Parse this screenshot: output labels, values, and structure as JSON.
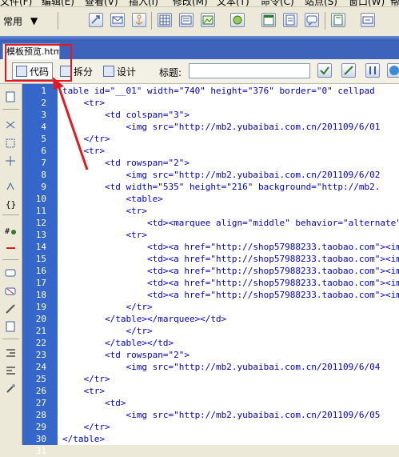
{
  "menubar": {
    "items": [
      "文件(F)",
      "编辑(E)",
      "查看(V)",
      "插入(I)",
      "修改(M)",
      "文本(T)",
      "命令(C)",
      "站点(S)",
      "窗口(W)",
      "帮"
    ]
  },
  "toolbar": {
    "category": "常用",
    "icons": [
      "hyperlink-icon",
      "email-link-icon",
      "named-anchor-icon",
      "table-icon",
      "div-icon",
      "image-icon",
      "media-icon",
      "date-icon",
      "server-include-icon",
      "comment-icon",
      "template-icon",
      "tag-chooser-icon"
    ]
  },
  "document_tab": {
    "label": "模板预览.htm"
  },
  "doc_toolbar": {
    "code_label": "代码",
    "split_label": "拆分",
    "design_label": "设计",
    "title_label": "标题:",
    "title_value": ""
  },
  "code_lines": [
    {
      "n": "1",
      "code": "table id=\"__01\" width=\"740\" height=\"376\" border=\"0\" cellpad"
    },
    {
      "n": "2",
      "code": "    <tr>"
    },
    {
      "n": "3",
      "code": "        <td colspan=\"3\">"
    },
    {
      "n": "4",
      "code": "            <img src=\"http://mb2.yubaibai.com.cn/201109/6/01"
    },
    {
      "n": "5",
      "code": "    </tr>"
    },
    {
      "n": "6",
      "code": "    <tr>"
    },
    {
      "n": "7",
      "code": "        <td rowspan=\"2\">"
    },
    {
      "n": "8",
      "code": "            <img src=\"http://mb2.yubaibai.com.cn/201109/6/02"
    },
    {
      "n": "9",
      "code": "        <td width=\"535\" height=\"216\" background=\"http://mb2."
    },
    {
      "n": "10",
      "code": "            <table>"
    },
    {
      "n": "11",
      "code": "            <tr>"
    },
    {
      "n": "12",
      "code": "                <td><marquee align=\"middle\" behavior=\"alternate\""
    },
    {
      "n": "13",
      "code": "            <tr>"
    },
    {
      "n": "14",
      "code": "                <td><a href=\"http://shop57988233.taobao.com\"><im"
    },
    {
      "n": "15",
      "code": "                <td><a href=\"http://shop57988233.taobao.com\"><im"
    },
    {
      "n": "16",
      "code": "                <td><a href=\"http://shop57988233.taobao.com\"><im"
    },
    {
      "n": "17",
      "code": "                <td><a href=\"http://shop57988233.taobao.com\"><im"
    },
    {
      "n": "18",
      "code": "                <td><a href=\"http://shop57988233.taobao.com\"><im"
    },
    {
      "n": "19",
      "code": "            </tr>"
    },
    {
      "n": "20",
      "code": "        </table></marquee></td>"
    },
    {
      "n": "21",
      "code": "            </tr>"
    },
    {
      "n": "22",
      "code": "        </table></td>"
    },
    {
      "n": "23",
      "code": "        <td rowspan=\"2\">"
    },
    {
      "n": "24",
      "code": "            <img src=\"http://mb2.yubaibai.com.cn/201109/6/04"
    },
    {
      "n": "25",
      "code": "    </tr>"
    },
    {
      "n": "26",
      "code": "    <tr>"
    },
    {
      "n": "27",
      "code": "        <td>"
    },
    {
      "n": "28",
      "code": "            <img src=\"http://mb2.yubaibai.com.cn/201109/6/05"
    },
    {
      "n": "29",
      "code": "    </tr>"
    },
    {
      "n": "30",
      "code": "</table>"
    },
    {
      "n": "31",
      "code": ""
    }
  ],
  "colors": {
    "gutter": "#3467c9",
    "code_tag": "#0000c8",
    "annotation": "#e4191f"
  }
}
